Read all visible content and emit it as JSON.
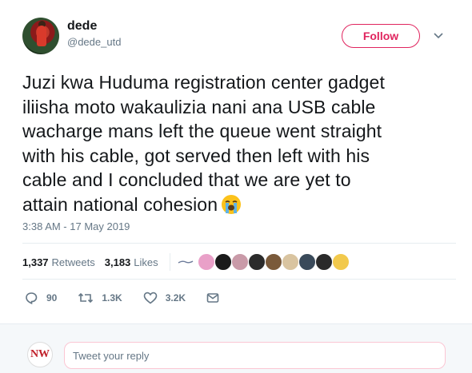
{
  "author": {
    "name": "dede",
    "handle": "@dede_utd"
  },
  "follow_label": "Follow",
  "tweet": {
    "lines": [
      "Juzi kwa Huduma registration center gadget",
      "iliisha moto wakaulizia nani ana USB cable",
      "wacharge mans left the queue went straight",
      "with his cable, got served then left with his",
      "cable and I concluded that we are yet to",
      "attain national cohesion"
    ],
    "emoji": "loudly-crying-face-emoji",
    "timestamp": "3:38 AM - 17 May 2019"
  },
  "stats": {
    "retweets_count": "1,337",
    "retweets_label": "Retweets",
    "likes_count": "3,183",
    "likes_label": "Likes"
  },
  "liker_colors": [
    "#e9a0c8",
    "#1a1a1a",
    "#c99aa8",
    "#2b2b2b",
    "#7a5a3a",
    "#d9c4a0",
    "#3a4a5a",
    "#2a2a2a",
    "#f2c94c"
  ],
  "actions": {
    "replies": "90",
    "retweets": "1.3K",
    "likes": "3.2K"
  },
  "reply": {
    "avatar_text": "NW",
    "placeholder": "Tweet your reply"
  },
  "colors": {
    "accent": "#e0245e",
    "secondary_text": "#657786",
    "primary_text": "#14171a"
  }
}
